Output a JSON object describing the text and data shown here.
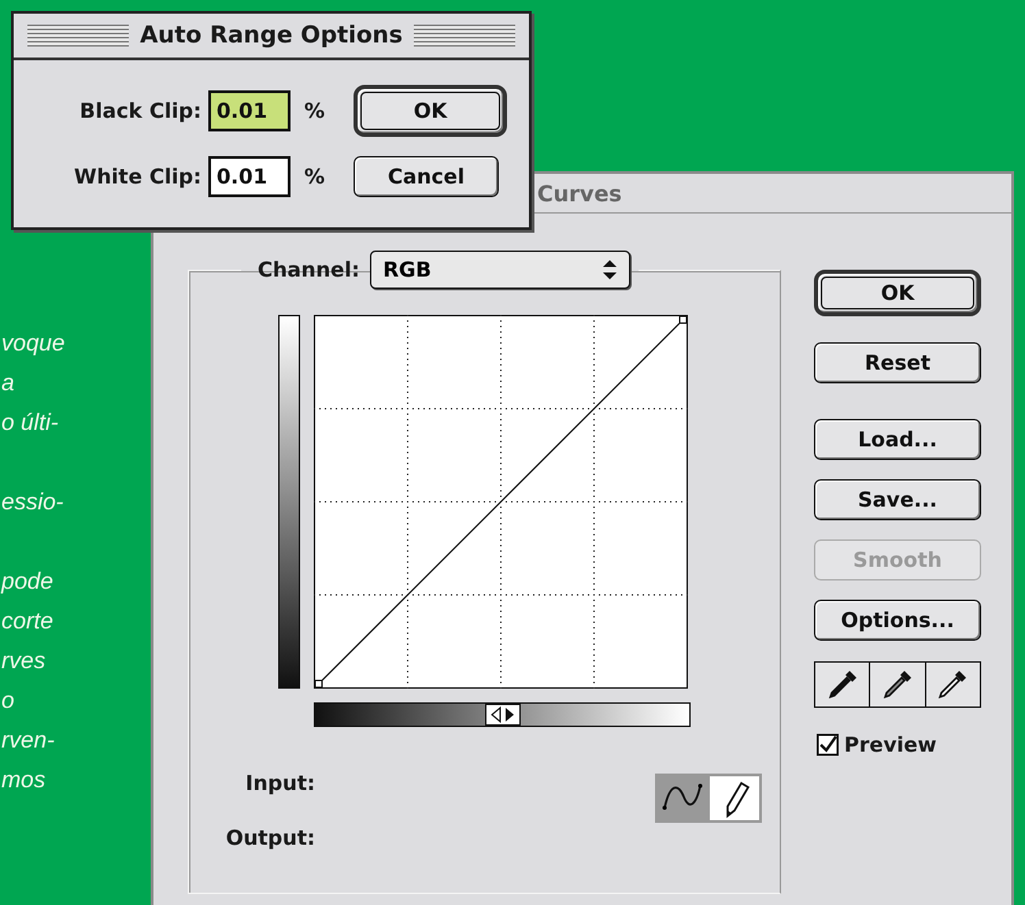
{
  "background_text": {
    "paragraphs": [
      [
        "voque",
        "a",
        "o últi-"
      ],
      [
        "essio-"
      ],
      [
        "pode",
        "corte",
        "rves",
        "o",
        "rven-",
        "mos"
      ]
    ]
  },
  "curves_window": {
    "title": "Curves",
    "channel": {
      "label": "Channel:",
      "value": "RGB"
    },
    "buttons": [
      {
        "label": "OK",
        "default": true,
        "disabled": false
      },
      {
        "label": "Reset",
        "default": false,
        "disabled": false
      },
      {
        "label": "Load...",
        "default": false,
        "disabled": false
      },
      {
        "label": "Save...",
        "default": false,
        "disabled": false
      },
      {
        "label": "Smooth",
        "default": false,
        "disabled": true
      },
      {
        "label": "Options...",
        "default": false,
        "disabled": false
      }
    ],
    "preview": {
      "label": "Preview",
      "checked": true
    },
    "input_label": "Input:",
    "output_label": "Output:",
    "tools": [
      {
        "kind": "curve",
        "selected": true
      },
      {
        "kind": "pencil",
        "selected": false
      }
    ]
  },
  "dialog": {
    "title": "Auto Range Options",
    "fields": [
      {
        "label": "Black Clip:",
        "value": "0.01",
        "unit": "%",
        "selected": true
      },
      {
        "label": "White Clip:",
        "value": "0.01",
        "unit": "%",
        "selected": false
      }
    ],
    "buttons": [
      {
        "label": "OK",
        "default": true
      },
      {
        "label": "Cancel",
        "default": false
      }
    ]
  }
}
